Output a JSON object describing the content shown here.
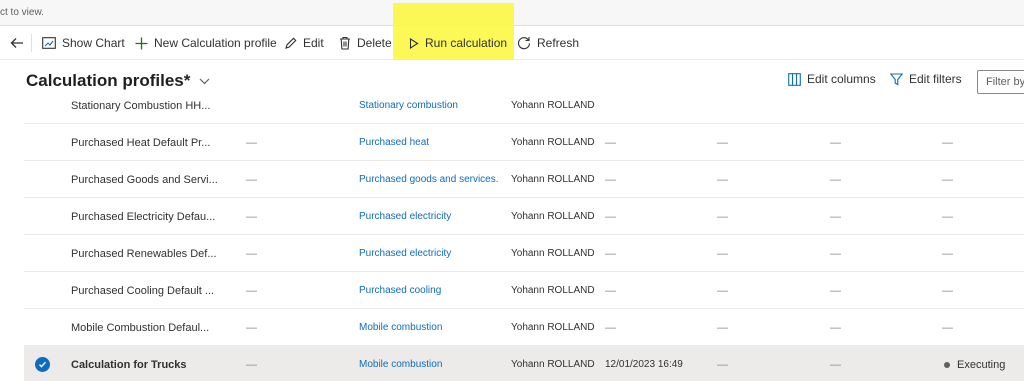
{
  "banner": {
    "text": "ct to view."
  },
  "commands": {
    "show_chart": "Show Chart",
    "new_profile": "New Calculation profile",
    "edit": "Edit",
    "delete": "Delete",
    "run": "Run calculation",
    "refresh": "Refresh"
  },
  "view": {
    "title": "Calculation profiles*",
    "edit_columns": "Edit columns",
    "edit_filters": "Edit filters",
    "filter_placeholder": "Filter by"
  },
  "rows": [
    {
      "name": "Stationary Combustion HH...",
      "col2": "",
      "source": "Stationary combustion",
      "owner": "Yohann ROLLAND",
      "date": "",
      "c6": "",
      "c7": "",
      "status": "",
      "selected": false
    },
    {
      "name": "Purchased Heat Default Pr...",
      "col2": "—",
      "source": "Purchased heat",
      "owner": "Yohann ROLLAND",
      "date": "—",
      "c6": "—",
      "c7": "—",
      "status": "—",
      "selected": false
    },
    {
      "name": "Purchased Goods and Servi...",
      "col2": "—",
      "source": "Purchased goods and services...",
      "owner": "Yohann ROLLAND",
      "date": "—",
      "c6": "—",
      "c7": "—",
      "status": "—",
      "selected": false
    },
    {
      "name": "Purchased Electricity Defau...",
      "col2": "—",
      "source": "Purchased electricity",
      "owner": "Yohann ROLLAND",
      "date": "—",
      "c6": "—",
      "c7": "—",
      "status": "—",
      "selected": false
    },
    {
      "name": "Purchased Renewables Def...",
      "col2": "—",
      "source": "Purchased electricity",
      "owner": "Yohann ROLLAND",
      "date": "—",
      "c6": "—",
      "c7": "—",
      "status": "—",
      "selected": false
    },
    {
      "name": "Purchased Cooling Default ...",
      "col2": "—",
      "source": "Purchased cooling",
      "owner": "Yohann ROLLAND",
      "date": "—",
      "c6": "—",
      "c7": "—",
      "status": "—",
      "selected": false
    },
    {
      "name": "Mobile Combustion Defaul...",
      "col2": "—",
      "source": "Mobile combustion",
      "owner": "Yohann ROLLAND",
      "date": "—",
      "c6": "—",
      "c7": "—",
      "status": "—",
      "selected": false
    },
    {
      "name": "Calculation for Trucks",
      "col2": "—",
      "source": "Mobile combustion",
      "owner": "Yohann ROLLAND",
      "date": "12/01/2023 16:49",
      "c6": "—",
      "c7": "—",
      "status": "Executing",
      "selected": true
    }
  ],
  "colors": {
    "accent": "#0f6cbd",
    "highlight": "#fbf83a",
    "selected_row": "#edebe9"
  }
}
